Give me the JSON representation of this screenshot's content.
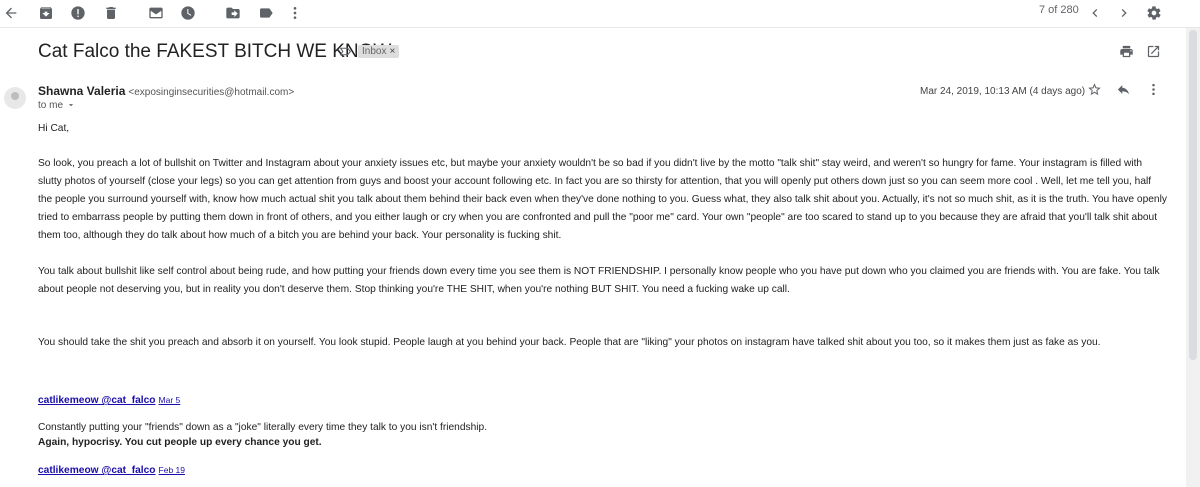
{
  "toolbar": {
    "back_icon": "arrow-left-icon",
    "archive_icon": "archive-icon",
    "spam_icon": "report-spam-icon",
    "delete_icon": "trash-icon",
    "unread_icon": "mark-unread-icon",
    "snooze_icon": "clock-icon",
    "move_icon": "folder-move-icon",
    "label_icon": "label-icon",
    "more_icon": "more-vert-icon",
    "pager_text": "7 of 280",
    "prev_icon": "chevron-left-icon",
    "next_icon": "chevron-right-icon",
    "settings_icon": "gear-icon"
  },
  "email": {
    "subject": "Cat Falco the FAKEST BITCH WE KNOW.",
    "label_chip": "Inbox",
    "chip_close": "×",
    "sender_name": "Shawna Valeria",
    "sender_email": "<exposinginsecurities@hotmail.com>",
    "to": "to me",
    "date": "Mar 24, 2019, 10:13 AM (4 days ago)"
  },
  "body": {
    "greeting": "Hi Cat,",
    "p1": "So look, you preach a lot of bullshit on Twitter and Instagram about your anxiety issues etc, but maybe your anxiety wouldn't be so bad if you didn't live by the motto \"talk shit\" stay weird, and weren't so hungry for fame. Your instagram is filled with slutty photos of yourself (close your legs) so you can get attention from guys and boost your account following etc. In fact you are so thirsty for attention, that you will openly put others down just so you can seem more cool . Well, let me tell you, half the people you  surround yourself with, know how much actual shit you talk about them behind their back even when they've done nothing to you. Guess what, they also talk shit about you. Actually, it's not so much shit, as it is the truth. You have openly tried to embarrass people by putting them down in front of others, and you either laugh or cry when you are confronted and pull the \"poor me\" card. Your own \"people\" are too scared to stand up to you because they are afraid that you'll talk shit about them too, although they do talk about how much of a bitch you are behind your back. Your personality is fucking shit.",
    "p2": "You talk about bullshit like self control about being rude, and how putting your friends down every time you see them is NOT FRIENDSHIP. I  personally know people who you have put down who you claimed you are friends with. You are fake. You talk about people not deserving you, but in reality you don't deserve them. Stop thinking you're THE SHIT, when you're nothing BUT SHIT. You need a fucking wake up call.",
    "p3": " You should take the shit you preach and absorb it on yourself. You look stupid. People laugh at you behind your back. People that are \"liking\" your photos on instagram have talked shit about you too, so it makes them just as fake as you.",
    "tweet1_handle": "catlikemeow @cat_falco",
    "tweet1_date": "Mar 5",
    "tweet1_text": "Constantly putting your \"friends\" down as a \"joke\" literally every time they talk to you isn't friendship.",
    "tweet1_bold": "Again, hypocrisy.  You cut people up every chance you get.",
    "tweet2_handle": "catlikemeow @cat_falco",
    "tweet2_date": "Feb 19"
  }
}
